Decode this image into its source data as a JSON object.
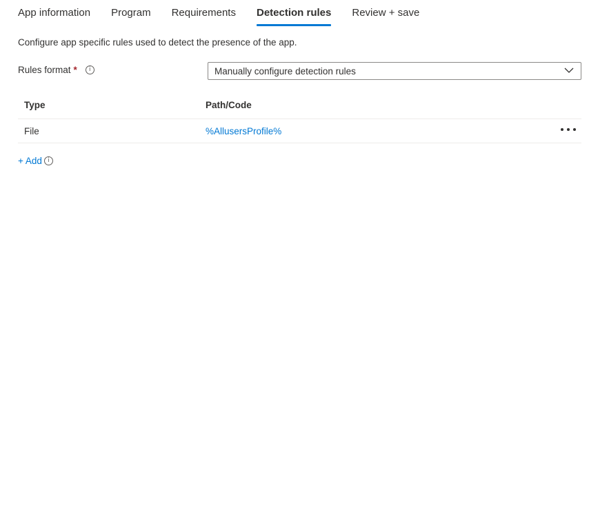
{
  "tabs": [
    {
      "label": "App information"
    },
    {
      "label": "Program"
    },
    {
      "label": "Requirements"
    },
    {
      "label": "Detection rules",
      "active": true
    },
    {
      "label": "Review + save"
    }
  ],
  "description": "Configure app specific rules used to detect the presence of the app.",
  "rules_format": {
    "label": "Rules format",
    "required_mark": "*",
    "info_icon": "info-icon",
    "selected_value": "Manually configure detection rules",
    "dropdown_icon": "chevron-down-icon"
  },
  "table": {
    "headers": [
      "Type",
      "Path/Code"
    ],
    "rows": [
      {
        "type": "File",
        "path": "%AllusersProfile%",
        "menu_icon": "more-icon"
      }
    ]
  },
  "add": {
    "label": "+ Add",
    "info_icon": "info-icon"
  },
  "colors": {
    "accent": "#0078d4",
    "required": "#a4262c",
    "text": "#323130",
    "border": "#8a8886"
  }
}
